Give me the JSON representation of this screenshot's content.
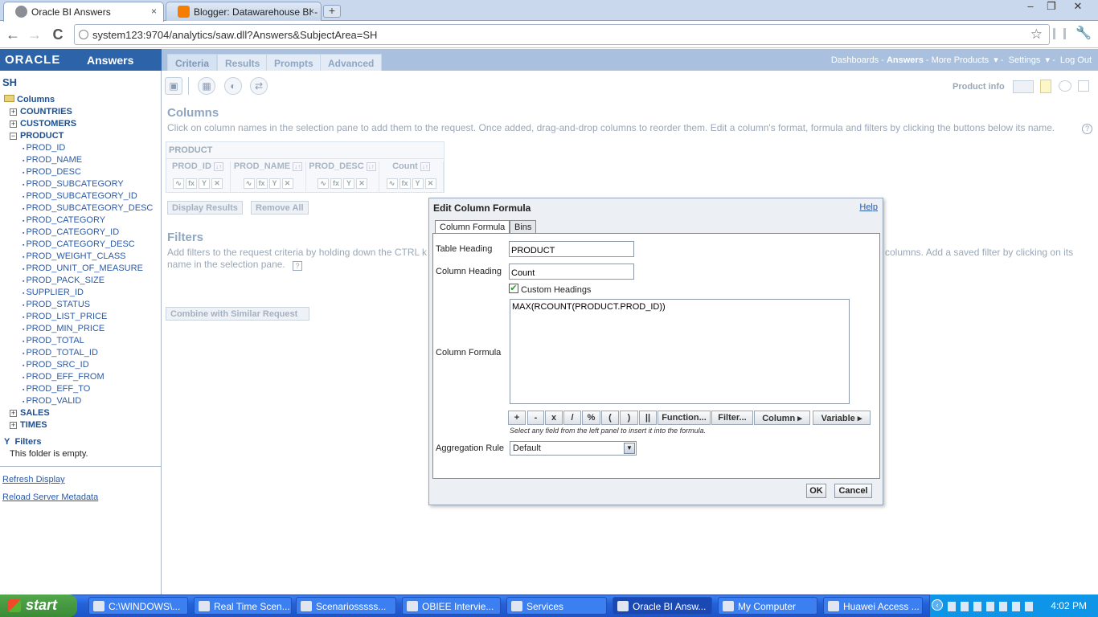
{
  "browser": {
    "tabs": [
      {
        "title": "Oracle BI Answers",
        "close": "×"
      },
      {
        "title": "Blogger: Datawarehouse BI - (",
        "close": "×"
      }
    ],
    "new_tab": "+",
    "window_buttons": [
      "–",
      "❐",
      "✕"
    ],
    "nav": {
      "back": "←",
      "forward": "→",
      "reload": "C"
    },
    "url": "system123:9704/analytics/saw.dll?Answers&SubjectArea=SH"
  },
  "app": {
    "brand": "ORACLE",
    "product": "Answers",
    "tabs": [
      "Criteria",
      "Results",
      "Prompts",
      "Advanced"
    ],
    "top_links": {
      "dashboards": "Dashboards",
      "sep": "-",
      "answers": "Answers",
      "more": "More Products",
      "settings": "Settings",
      "logout": "Log Out"
    },
    "product_info": "Product info"
  },
  "left_panel": {
    "subject_area": "SH",
    "columns_label": "Columns",
    "folders": [
      {
        "label": "COUNTRIES",
        "toggle": "+"
      },
      {
        "label": "CUSTOMERS",
        "toggle": "+"
      },
      {
        "label": "PRODUCT",
        "toggle": "−"
      }
    ],
    "product_columns": [
      "PROD_ID",
      "PROD_NAME",
      "PROD_DESC",
      "PROD_SUBCATEGORY",
      "PROD_SUBCATEGORY_ID",
      "PROD_SUBCATEGORY_DESC",
      "PROD_CATEGORY",
      "PROD_CATEGORY_ID",
      "PROD_CATEGORY_DESC",
      "PROD_WEIGHT_CLASS",
      "PROD_UNIT_OF_MEASURE",
      "PROD_PACK_SIZE",
      "SUPPLIER_ID",
      "PROD_STATUS",
      "PROD_LIST_PRICE",
      "PROD_MIN_PRICE",
      "PROD_TOTAL",
      "PROD_TOTAL_ID",
      "PROD_SRC_ID",
      "PROD_EFF_FROM",
      "PROD_EFF_TO",
      "PROD_VALID"
    ],
    "more_folders": [
      {
        "label": "SALES",
        "toggle": "+"
      },
      {
        "label": "TIMES",
        "toggle": "+"
      }
    ],
    "filters_label": "Filters",
    "filters_empty": "This folder is empty.",
    "refresh": "Refresh Display",
    "reload": "Reload Server Metadata"
  },
  "main": {
    "columns_title": "Columns",
    "columns_help": "Click on column names in the selection pane to add them to the request. Once added, drag-and-drop columns to reorder them. Edit a column's format, formula and filters by clicking the buttons below its name.",
    "help_mark": "?",
    "criteria_group": "PRODUCT",
    "criteria_columns": [
      "PROD_ID",
      "PROD_NAME",
      "PROD_DESC",
      "Count"
    ],
    "sort_glyph": "↓↑",
    "col_buttons": [
      "∿",
      "fx",
      "Y",
      "✕"
    ],
    "display_results": "Display Results",
    "remove_all": "Remove All",
    "filters_title": "Filters",
    "filters_help_left": "Add filters to the request criteria by holding down the CTRL k",
    "filters_help_right": "columns. Add a saved filter by clicking on its",
    "filters_help_line2": "name in the selection pane.",
    "combine": "Combine with Similar Request"
  },
  "dialog": {
    "title": "Edit Column Formula",
    "help": "Help",
    "tabs": [
      "Column Formula",
      "Bins"
    ],
    "table_heading_label": "Table Heading",
    "table_heading_value": "PRODUCT",
    "column_heading_label": "Column Heading",
    "column_heading_value": "Count",
    "custom_headings": "Custom Headings",
    "custom_headings_checked": true,
    "formula_label": "Column Formula",
    "formula_value": "MAX(RCOUNT(PRODUCT.PROD_ID))",
    "formula_buttons": [
      "+",
      "-",
      "x",
      "/",
      "%",
      "(",
      ")",
      "||",
      "Function...",
      "Filter...",
      "Column ▸",
      "Variable ▸"
    ],
    "hint": "Select any field from the left panel to insert it into the formula.",
    "aggregation_label": "Aggregation Rule",
    "aggregation_value": "Default",
    "ok": "OK",
    "cancel": "Cancel"
  },
  "taskbar": {
    "start": "start",
    "tasks": [
      "C:\\WINDOWS\\...",
      "Real Time Scen...",
      "Scenariosssss...",
      "OBIEE  Intervie...",
      "Services",
      "Oracle BI Answ...",
      "My Computer",
      "Huawei Access ..."
    ],
    "clock": "4:02 PM"
  }
}
